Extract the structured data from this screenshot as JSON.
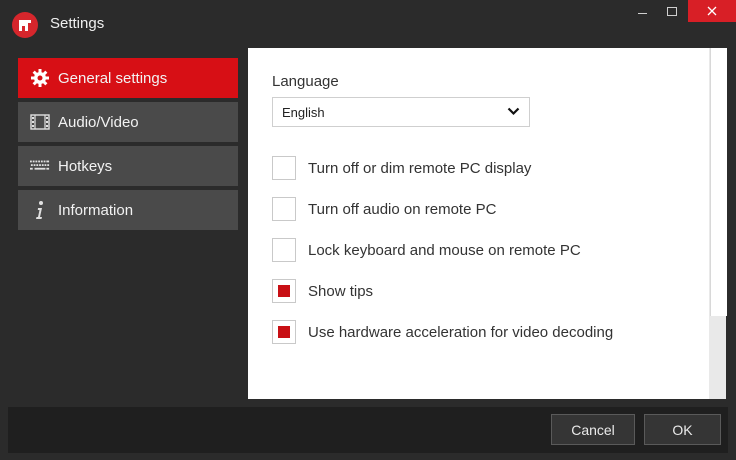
{
  "window": {
    "title": "Settings"
  },
  "sidebar": {
    "items": [
      {
        "label": "General settings",
        "icon": "gear-icon",
        "active": true
      },
      {
        "label": "Audio/Video",
        "icon": "film-icon",
        "active": false
      },
      {
        "label": "Hotkeys",
        "icon": "keyboard-icon",
        "active": false
      },
      {
        "label": "Information",
        "icon": "info-icon",
        "active": false
      }
    ]
  },
  "general": {
    "language_label": "Language",
    "language_value": "English",
    "options": [
      {
        "label": "Turn off or dim remote PC display",
        "checked": false
      },
      {
        "label": "Turn off audio on remote PC",
        "checked": false
      },
      {
        "label": "Lock keyboard and mouse on remote PC",
        "checked": false
      },
      {
        "label": "Show tips",
        "checked": true
      },
      {
        "label": "Use hardware acceleration for video decoding",
        "checked": true
      }
    ]
  },
  "footer": {
    "cancel_label": "Cancel",
    "ok_label": "OK"
  },
  "colors": {
    "accent": "#d70f15",
    "background": "#2b2b2b",
    "sidebar_item": "#4a4a4a"
  }
}
